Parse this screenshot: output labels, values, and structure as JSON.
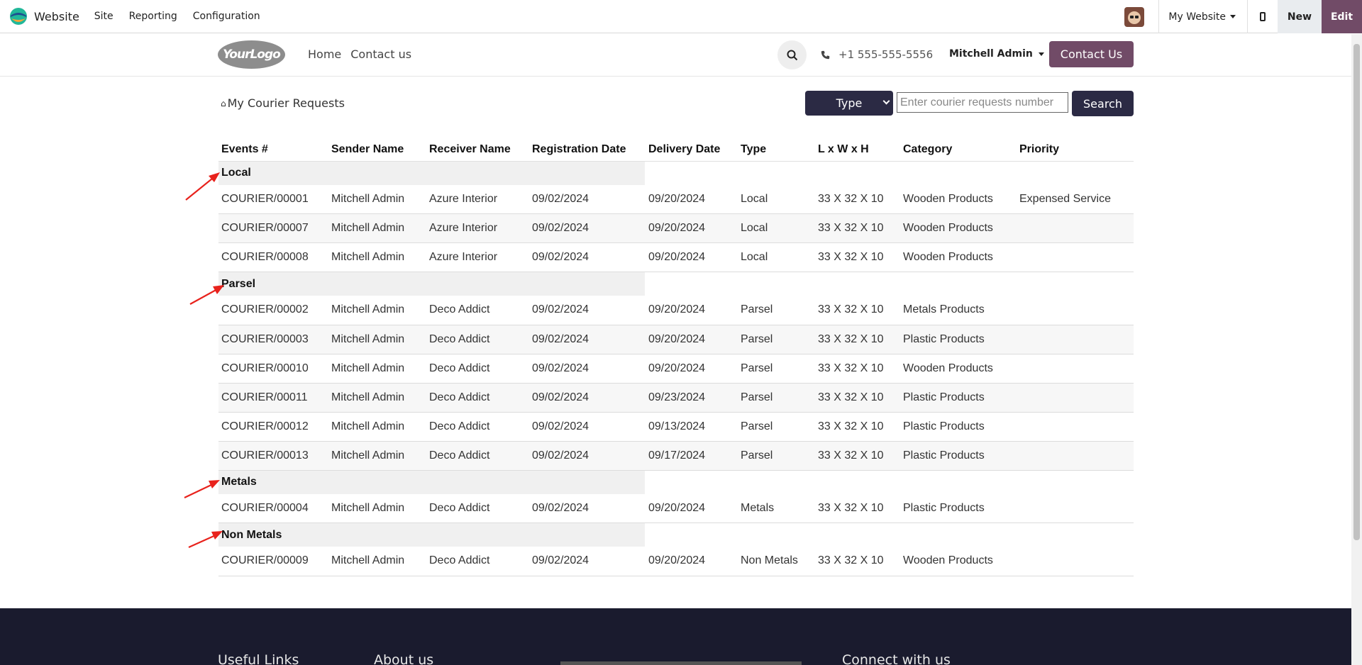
{
  "topbar": {
    "app_name": "Website",
    "menu": [
      "Site",
      "Reporting",
      "Configuration"
    ],
    "website_selector": "My Website",
    "new_label": "New",
    "edit_label": "Edit"
  },
  "site_header": {
    "logo_text": "YourLogo",
    "nav": [
      "Home",
      "Contact us"
    ],
    "phone": "+1 555-555-5556",
    "user": "Mitchell Admin",
    "contact_button": "Contact Us"
  },
  "page": {
    "breadcrumb": "My Courier Requests",
    "type_select": "Type",
    "search_placeholder": "Enter courier requests number",
    "search_button": "Search"
  },
  "table": {
    "headers": [
      "Events #",
      "Sender Name",
      "Receiver Name",
      "Registration Date",
      "Delivery Date",
      "Type",
      "L x W x H",
      "Category",
      "Priority"
    ],
    "groups": [
      {
        "name": "Local",
        "rows": [
          [
            "COURIER/00001",
            "Mitchell Admin",
            "Azure Interior",
            "09/02/2024",
            "09/20/2024",
            "Local",
            "33 X 32 X 10",
            "Wooden Products",
            "Expensed Service"
          ],
          [
            "COURIER/00007",
            "Mitchell Admin",
            "Azure Interior",
            "09/02/2024",
            "09/20/2024",
            "Local",
            "33 X 32 X 10",
            "Wooden Products",
            ""
          ],
          [
            "COURIER/00008",
            "Mitchell Admin",
            "Azure Interior",
            "09/02/2024",
            "09/20/2024",
            "Local",
            "33 X 32 X 10",
            "Wooden Products",
            ""
          ]
        ]
      },
      {
        "name": "Parsel",
        "rows": [
          [
            "COURIER/00002",
            "Mitchell Admin",
            "Deco Addict",
            "09/02/2024",
            "09/20/2024",
            "Parsel",
            "33 X 32 X 10",
            "Metals Products",
            ""
          ],
          [
            "COURIER/00003",
            "Mitchell Admin",
            "Deco Addict",
            "09/02/2024",
            "09/20/2024",
            "Parsel",
            "33 X 32 X 10",
            "Plastic Products",
            ""
          ],
          [
            "COURIER/00010",
            "Mitchell Admin",
            "Deco Addict",
            "09/02/2024",
            "09/20/2024",
            "Parsel",
            "33 X 32 X 10",
            "Wooden Products",
            ""
          ],
          [
            "COURIER/00011",
            "Mitchell Admin",
            "Deco Addict",
            "09/02/2024",
            "09/23/2024",
            "Parsel",
            "33 X 32 X 10",
            "Plastic Products",
            ""
          ],
          [
            "COURIER/00012",
            "Mitchell Admin",
            "Deco Addict",
            "09/02/2024",
            "09/13/2024",
            "Parsel",
            "33 X 32 X 10",
            "Plastic Products",
            ""
          ],
          [
            "COURIER/00013",
            "Mitchell Admin",
            "Deco Addict",
            "09/02/2024",
            "09/17/2024",
            "Parsel",
            "33 X 32 X 10",
            "Plastic Products",
            ""
          ]
        ]
      },
      {
        "name": "Metals",
        "rows": [
          [
            "COURIER/00004",
            "Mitchell Admin",
            "Deco Addict",
            "09/02/2024",
            "09/20/2024",
            "Metals",
            "33 X 32 X 10",
            "Plastic Products",
            ""
          ]
        ]
      },
      {
        "name": "Non Metals",
        "rows": [
          [
            "COURIER/00009",
            "Mitchell Admin",
            "Deco Addict",
            "09/02/2024",
            "09/20/2024",
            "Non Metals",
            "33 X 32 X 10",
            "Wooden Products",
            ""
          ]
        ]
      }
    ]
  },
  "footer": {
    "headings": [
      "Useful Links",
      "About us",
      "Connect with us"
    ]
  },
  "colors": {
    "brand": "#714b67",
    "dark_button": "#2b2a44",
    "footer_bg": "#1a1b2e",
    "annotation_arrow": "#e8221c"
  }
}
